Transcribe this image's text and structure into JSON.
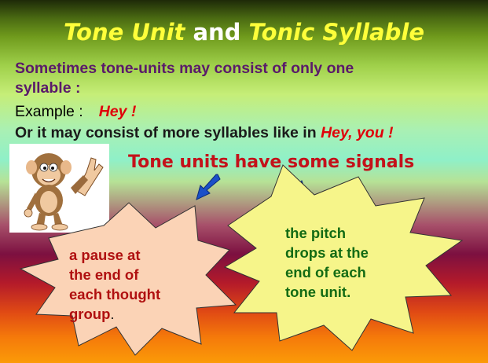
{
  "slide": {
    "title_part1": "Tone Unit",
    "title_and": " and ",
    "title_part2": "Tonic Syllable",
    "line1": "Sometimes tone-units may consist of only one",
    "line2": "syllable :",
    "example_label": "Example :",
    "example_word": "Hey !",
    "line4_text": "Or it may consist of more syllables like in ",
    "line4_example": "Hey, you !",
    "signals_heading": "Tone units have some signals",
    "burst_left": {
      "line1": "a pause at",
      "line2": "the end of",
      "line3": "each thought",
      "line4": "group",
      "punct": "."
    },
    "burst_right": {
      "line1": "the pitch",
      "line2": "drops at the",
      "line3": "end of each",
      "line4": "tone unit."
    }
  },
  "colors": {
    "title": "#ffff3a",
    "purple_text": "#5a1a6a",
    "red_text": "#e0000a",
    "signals": "#c4121a",
    "burst_left_fill": "#fbd3b6",
    "burst_right_fill": "#f6f58a",
    "burst_right_text": "#136b14",
    "arrow_blue": "#1a50c8"
  },
  "icons": [
    "waving-monkey-illustration",
    "down-left-arrow-icon",
    "down-right-arrow-icon"
  ]
}
